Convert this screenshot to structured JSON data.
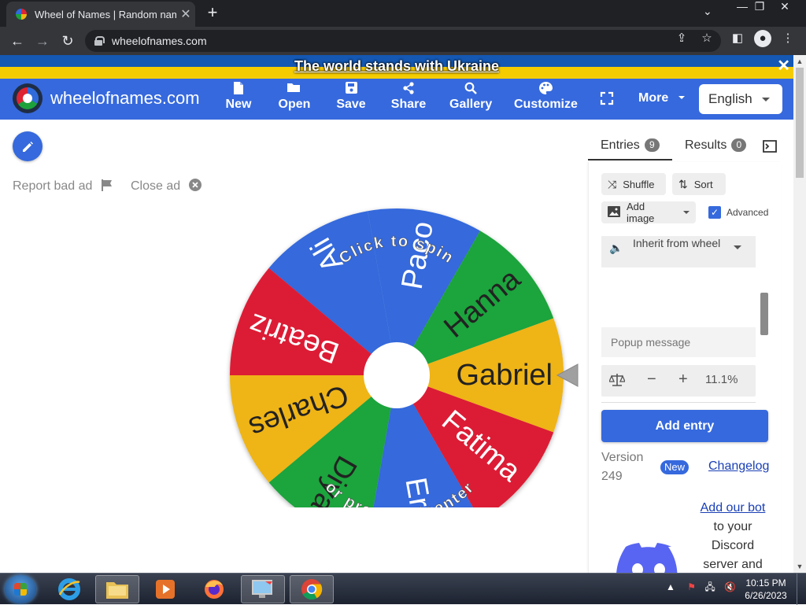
{
  "browser": {
    "tab_title": "Wheel of Names | Random name",
    "tab_close": "✕",
    "new_tab": "+",
    "url": "wheelofnames.com"
  },
  "banner": {
    "text": "The world stands with Ukraine",
    "close": "✕"
  },
  "header": {
    "site_name": "wheelofnames.com",
    "menu": [
      {
        "label": "New",
        "icon": "file-icon"
      },
      {
        "label": "Open",
        "icon": "folder-open-icon"
      },
      {
        "label": "Save",
        "icon": "save-icon"
      },
      {
        "label": "Share",
        "icon": "share-icon"
      },
      {
        "label": "Gallery",
        "icon": "search-icon"
      },
      {
        "label": "Customize",
        "icon": "palette-icon"
      }
    ],
    "more": "More",
    "language": "English"
  },
  "ad": {
    "report": "Report bad ad",
    "close": "Close ad"
  },
  "wheel": {
    "entries": [
      "Ali",
      "Paco",
      "Hanna",
      "Gabriel",
      "Fatima",
      "Eric",
      "Diya",
      "Charles",
      "Beatriz"
    ],
    "top_text": "Click to spin",
    "bottom_text": "or press ctrl+enter",
    "colors": {
      "blue": "#3469dc",
      "green": "#1ea43c",
      "yellow": "#efb417",
      "red": "#dc1f35"
    }
  },
  "sidebar": {
    "tabs": [
      {
        "label": "Entries",
        "count": "9"
      },
      {
        "label": "Results",
        "count": "0"
      }
    ],
    "shuffle": "Shuffle",
    "sort": "Sort",
    "add_image": "Add image",
    "advanced": "Advanced",
    "inherit": "Inherit from wheel",
    "popup_placeholder": "Popup message",
    "weight_minus": "−",
    "weight_plus": "+",
    "weight": "11.1%",
    "add_entry": "Add entry",
    "version": "Version 249",
    "new_badge": "New",
    "changelog": "Changelog",
    "discord_link": "Add our bot",
    "discord_text": "to your Discord server and spin wheels from within Discord!"
  },
  "taskbar": {
    "time": "10:15 PM",
    "date": "6/26/2023"
  }
}
